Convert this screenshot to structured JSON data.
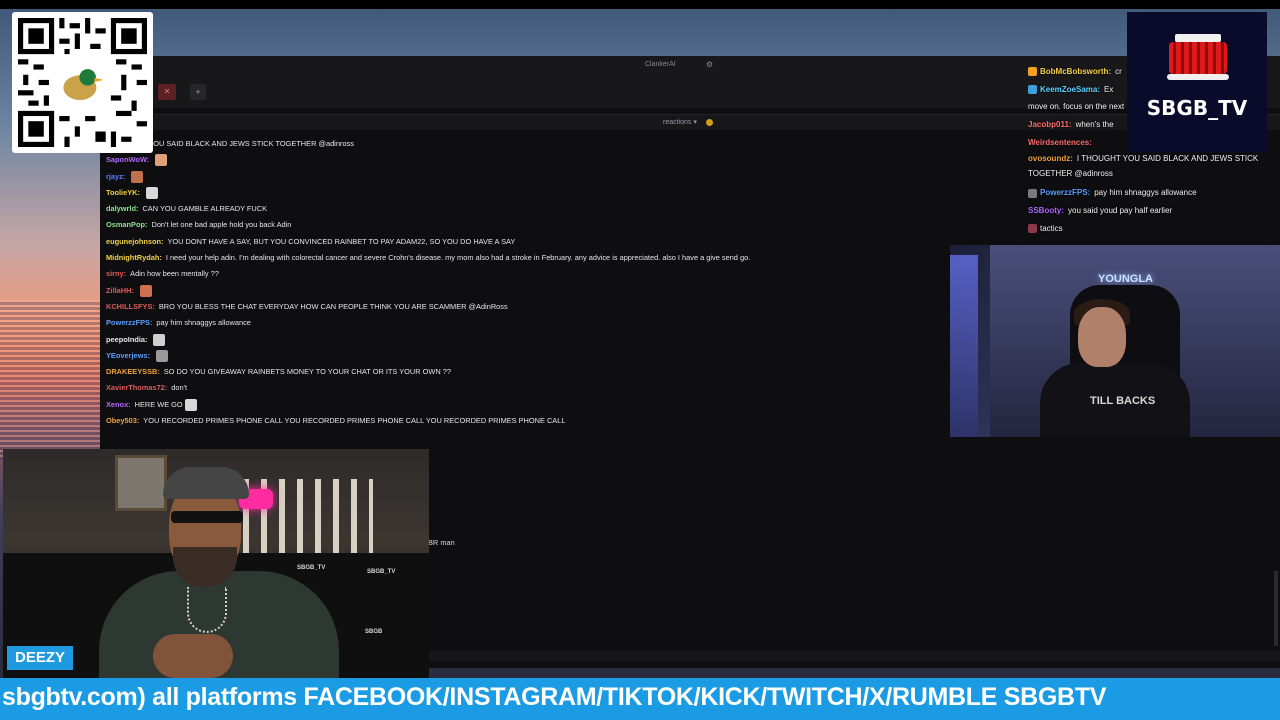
{
  "browser": {
    "tab_title": "ClankerAI",
    "reactions_label": "reactions ▾"
  },
  "chat": [
    {
      "user": "",
      "user_color": "#e6e6ea",
      "text": "I THOUGHT YOU SAID BLACK AND JEWS STICK TOGETHER @adinross",
      "emote": false
    },
    {
      "user": "SaponWoW:",
      "user_color": "#b066ff",
      "text": "",
      "emote": true,
      "emote_color": "#e0a07a"
    },
    {
      "user": "rjayz:",
      "user_color": "#5a7dff",
      "text": "",
      "emote": true,
      "emote_color": "#c0704a"
    },
    {
      "user": "ToolieYK:",
      "user_color": "#f2d14a",
      "text": "",
      "emote": true,
      "emote_color": "#d8d8d8"
    },
    {
      "user": "dalywrld:",
      "user_color": "#8fe08f",
      "text": "CAN YOU GAMBLE ALREADY FUCK",
      "emote": false
    },
    {
      "user": "OsmanPop:",
      "user_color": "#8fe08f",
      "text": "Don't let one bad apple hold you back Adin",
      "emote": false
    },
    {
      "user": "eugunejohnson:",
      "user_color": "#f2d14a",
      "text": "YOU DONT HAVE A SAY, BUT YOU CONVINCED RAINBET TO PAY ADAM22, SO YOU DO HAVE A SAY",
      "emote": false
    },
    {
      "user": "MidnightRydah:",
      "user_color": "#f2d14a",
      "text": "I need your help adin. I'm dealing with colorectal cancer and severe Crohn's disease. my mom also had a stroke in February. any advice is appreciated. also I have a give send go.",
      "emote": false
    },
    {
      "user": "sirny:",
      "user_color": "#e05a5a",
      "text": "Adin how been mentally ??",
      "emote": false
    },
    {
      "user": "ZillaHH:",
      "user_color": "#e05a5a",
      "text": "",
      "emote": true,
      "emote_color": "#d07050"
    },
    {
      "user": "KCHILLSFYS:",
      "user_color": "#e05a5a",
      "text": "BRO YOU BLESS THE CHAT EVERYDAY HOW CAN PEOPLE THINK YOU ARE SCAMMER @AdinRoss",
      "emote": false
    },
    {
      "user": "PowerzzFPS:",
      "user_color": "#5a9dff",
      "text": "pay him shnaggys allowance",
      "emote": false
    },
    {
      "user": "peepoIndia:",
      "user_color": "#e6e6ea",
      "text": "",
      "emote": true,
      "emote_color": "#cfcfcf"
    },
    {
      "user": "YEoverjews:",
      "user_color": "#5a9dff",
      "text": "",
      "emote": true,
      "emote_color": "#9a9a9a"
    },
    {
      "user": "DRAKEEYSSB:",
      "user_color": "#f0a040",
      "text": "SO DO YOU GIVEAWAY RAINBETS MONEY TO YOUR CHAT OR ITS YOUR OWN ??",
      "emote": false
    },
    {
      "user": "XavierThomas72:",
      "user_color": "#e05a5a",
      "text": "don't",
      "emote": false
    },
    {
      "user": "Xenox:",
      "user_color": "#b066ff",
      "text": "HERE WE GO",
      "emote": true,
      "emote_color": "#d8d8d8"
    },
    {
      "user": "Obey503:",
      "user_color": "#f0a040",
      "text": "YOU RECORDED PRIMES PHONE CALL YOU RECORDED PRIMES PHONE CALL YOU RECORDED PRIMES PHONE CALL",
      "emote": false
    }
  ],
  "chat_partial": "BR man",
  "overlay_chat": [
    {
      "user": "BobMcBobsworth:",
      "user_color": "#f2d14a",
      "text": "cr",
      "badge_color": "#f2a020"
    },
    {
      "user": "KeemZoeSama:",
      "user_color": "#5ad2ff",
      "text": "Ex",
      "badge_color": "#3aa0e0"
    },
    {
      "user": "",
      "user_color": "#f2f2f2",
      "text": "move on. focus on the next",
      "badge_color": ""
    },
    {
      "user": "Jacobp011:",
      "user_color": "#ff6a6a",
      "text": "when's the",
      "badge_color": ""
    },
    {
      "user": "Weirdsentences:",
      "user_color": "#ff6a6a",
      "text": "",
      "badge_color": ""
    },
    {
      "user": "ovosoundz:",
      "user_color": "#f0a040",
      "text": "I THOUGHT YOU SAID BLACK AND JEWS STICK TOGETHER @adinross",
      "badge_color": "",
      "tall": true
    },
    {
      "user": "PowerzzFPS:",
      "user_color": "#5a9dff",
      "text": "pay him shnaggys allowance",
      "badge_color": "#7a7a7a"
    },
    {
      "user": "SSBooty:",
      "user_color": "#b066ff",
      "text": "you said youd pay half earlier",
      "badge_color": ""
    },
    {
      "user": "",
      "user_color": "#f2f2f2",
      "text": "tactics",
      "badge_color": "#8a3a4a"
    }
  ],
  "cam_right": {
    "neon_sign": "YOUNGLA",
    "shirt_print": "TILL BACKS"
  },
  "cam_left": {
    "name_tag": "DEEZY",
    "pillow_1": "SBGB_TV",
    "pillow_2": "SBGB_TV",
    "pillow_3": "SBGB"
  },
  "logo": {
    "text": "SBGB_TV"
  },
  "qr": {
    "icon": "qr-code-duck-icon"
  },
  "ticker": {
    "text": "sbgbtv.com) all platforms FACEBOOK/INSTAGRAM/TIKTOK/KICK/TWITCH/X/RUMBLE SBGBTV"
  },
  "colors": {
    "ticker_bg": "#1a9be4",
    "name_tag_bg": "#1f9ae0",
    "logo_bg": "#0a0b2a"
  }
}
